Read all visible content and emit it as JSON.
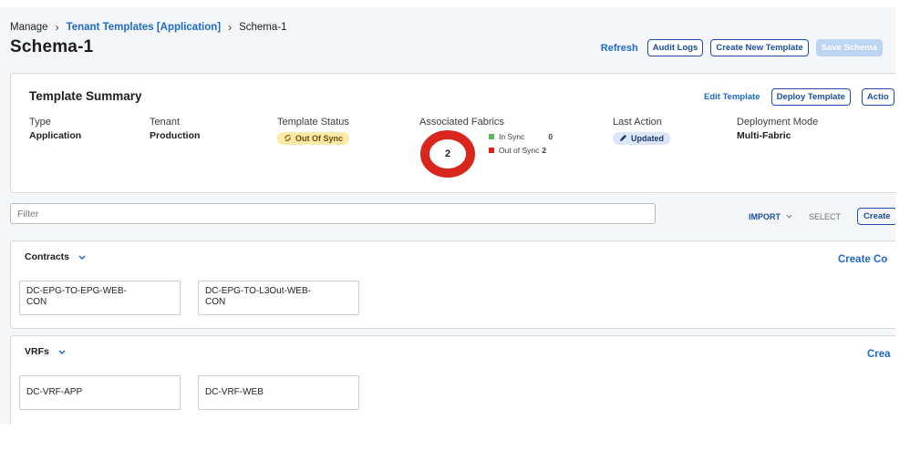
{
  "breadcrumb": {
    "root": "Manage",
    "parent": "Tenant Templates [Application]",
    "current": "Schema-1"
  },
  "page_title": "Schema-1",
  "header_actions": {
    "refresh": "Refresh",
    "audit_logs": "Audit Logs",
    "create_new_template": "Create New Template",
    "save_schema": "Save Schema"
  },
  "summary": {
    "title": "Template Summary",
    "edit_template": "Edit Template",
    "deploy_template": "Deploy Template",
    "actions": "Actio",
    "type": {
      "label": "Type",
      "value": "Application"
    },
    "tenant": {
      "label": "Tenant",
      "value": "Production"
    },
    "template_status": {
      "label": "Template Status",
      "value": "Out Of Sync"
    },
    "associated_fabrics": {
      "label": "Associated Fabrics",
      "total": "2",
      "in_sync": {
        "label": "In Sync",
        "count": "0",
        "color": "#5cb85c"
      },
      "out_of_sync": {
        "label": "Out of Sync",
        "count": "2",
        "color": "#d9261c"
      }
    },
    "last_action": {
      "label": "Last Action",
      "value": "Updated"
    },
    "deployment_mode": {
      "label": "Deployment Mode",
      "value": "Multi-Fabric"
    }
  },
  "filter": {
    "placeholder": "Filter"
  },
  "toolbar": {
    "import": "IMPORT",
    "select": "SELECT",
    "create": "Create"
  },
  "contracts": {
    "title": "Contracts",
    "create": "Create Co",
    "items": [
      {
        "line1": "DC-EPG-TO-EPG-WEB-",
        "line2": "CON"
      },
      {
        "line1": "DC-EPG-TO-L3Out-WEB-",
        "line2": "CON"
      }
    ]
  },
  "vrfs": {
    "title": "VRFs",
    "create": "Crea",
    "items": [
      {
        "label": "DC-VRF-APP"
      },
      {
        "label": "DC-VRF-WEB"
      }
    ]
  },
  "colors": {
    "accent": "#1d69cc",
    "accent_dark": "#1d4fa0",
    "warning_bg": "#fde9a8",
    "info_bg": "#dbe7f8",
    "disabled_btn": "#bcd5f2"
  }
}
